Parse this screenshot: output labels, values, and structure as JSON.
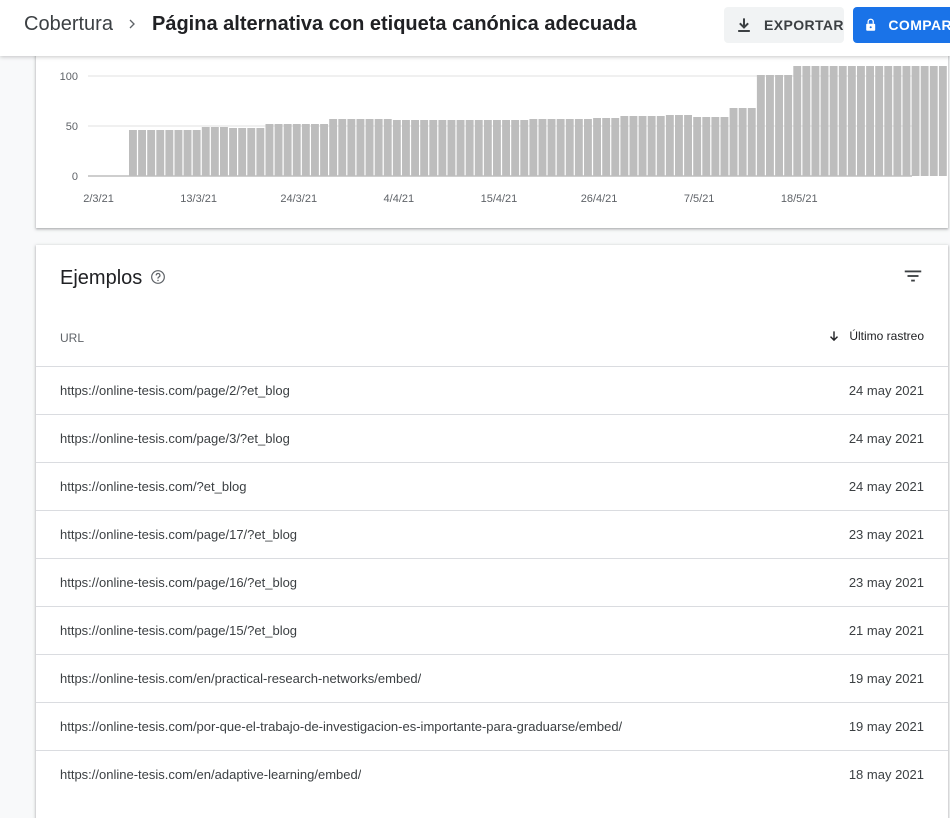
{
  "header": {
    "breadcrumb": "Cobertura",
    "title": "Página alternativa con etiqueta canónica adecuada",
    "export_label": "EXPORTAR",
    "compare_label": "COMPARAR"
  },
  "colors": {
    "bar": "#bdbdbd",
    "accent": "#1a73e8",
    "grid": "#e0e0e0"
  },
  "chart_data": {
    "type": "bar",
    "ylim": [
      0,
      110
    ],
    "yticks": [
      0,
      50,
      100
    ],
    "x_tick_labels": [
      "2/3/21",
      "13/3/21",
      "24/3/21",
      "4/4/21",
      "15/4/21",
      "26/4/21",
      "7/5/21",
      "18/5/21"
    ],
    "x_tick_index": [
      0,
      11,
      22,
      33,
      44,
      55,
      66,
      77
    ],
    "values": [
      0,
      0,
      0,
      0,
      46,
      46,
      46,
      46,
      46,
      46,
      46,
      46,
      49,
      49,
      49,
      48,
      48,
      48,
      48,
      52,
      52,
      52,
      52,
      52,
      52,
      52,
      57,
      57,
      57,
      57,
      57,
      57,
      57,
      56,
      56,
      56,
      56,
      56,
      56,
      56,
      56,
      56,
      56,
      56,
      56,
      56,
      56,
      56,
      57,
      57,
      57,
      57,
      57,
      57,
      57,
      58,
      58,
      58,
      60,
      60,
      60,
      60,
      60,
      61,
      61,
      61,
      59,
      59,
      59,
      59,
      68,
      68,
      68,
      101,
      101,
      101,
      101,
      110,
      110,
      110,
      110,
      110,
      110,
      110,
      110,
      110,
      110,
      110,
      110,
      110,
      110,
      110,
      110,
      110
    ]
  },
  "examples": {
    "title": "Ejemplos",
    "col_url": "URL",
    "col_date": "Último rastreo",
    "rows": [
      {
        "url": "https://online-tesis.com/page/2/?et_blog",
        "date": "24 may 2021"
      },
      {
        "url": "https://online-tesis.com/page/3/?et_blog",
        "date": "24 may 2021"
      },
      {
        "url": "https://online-tesis.com/?et_blog",
        "date": "24 may 2021"
      },
      {
        "url": "https://online-tesis.com/page/17/?et_blog",
        "date": "23 may 2021"
      },
      {
        "url": "https://online-tesis.com/page/16/?et_blog",
        "date": "23 may 2021"
      },
      {
        "url": "https://online-tesis.com/page/15/?et_blog",
        "date": "21 may 2021"
      },
      {
        "url": "https://online-tesis.com/en/practical-research-networks/embed/",
        "date": "19 may 2021"
      },
      {
        "url": "https://online-tesis.com/por-que-el-trabajo-de-investigacion-es-importante-para-graduarse/embed/",
        "date": "19 may 2021"
      },
      {
        "url": "https://online-tesis.com/en/adaptive-learning/embed/",
        "date": "18 may 2021"
      }
    ]
  }
}
